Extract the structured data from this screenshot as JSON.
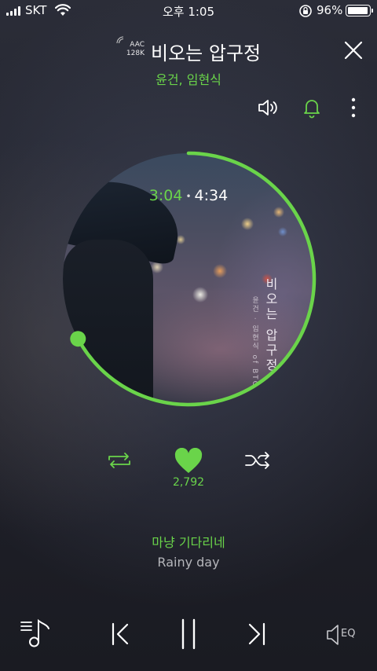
{
  "status_bar": {
    "carrier": "SKT",
    "time": "오후 1:05",
    "battery": "96%"
  },
  "header": {
    "quality_codec": "AAC",
    "quality_bitrate": "128K",
    "song_title": "비오는 압구정",
    "artist": "윤건, 임현식"
  },
  "album": {
    "cover_title": "비오는 압구정",
    "cover_subtitle": "윤건 · 임현식 of BTOB"
  },
  "playback": {
    "current_time": "3:04",
    "separator": "•",
    "total_time": "4:34",
    "progress": 0.671
  },
  "actions": {
    "like_count": "2,792"
  },
  "lyrics": {
    "current": "마냥 기다리네",
    "translation": "Rainy day"
  },
  "bottom_bar": {
    "eq_label": "EQ"
  },
  "colors": {
    "accent": "#6ad44a",
    "background": "#23252f"
  }
}
